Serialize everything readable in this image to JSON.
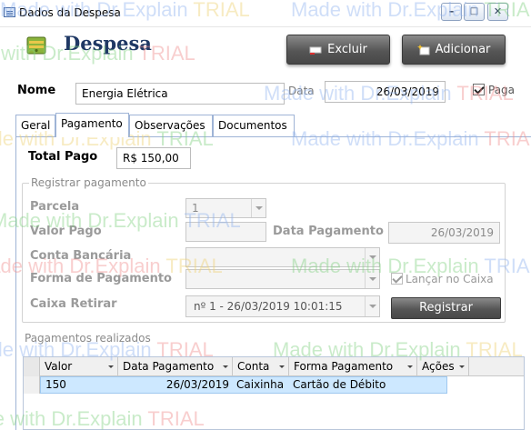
{
  "window": {
    "title": "Dados da Despesa",
    "minimize": "–",
    "maximize": "□",
    "close": "✕"
  },
  "header": {
    "title": "Despesa",
    "icon": "money-icon",
    "delete_label": "Excluir",
    "add_label": "Adicionar"
  },
  "form": {
    "name_label": "Nome",
    "name_value": "Energia Elétrica",
    "date_label": "Data",
    "date_value": "26/03/2019",
    "paid_label": "Paga",
    "paid_checked": true
  },
  "tabs": [
    "Geral",
    "Pagamento",
    "Observações",
    "Documentos"
  ],
  "active_tab": "Pagamento",
  "payment": {
    "total_label": "Total Pago",
    "total_value": "R$ 150,00",
    "group_title": "Registrar pagamento",
    "installment_label": "Parcela",
    "installment_value": "1",
    "amount_label": "Valor Pago",
    "amount_value": "",
    "pay_date_label": "Data Pagamento",
    "pay_date_value": "26/03/2019",
    "bank_label": "Conta Bancária",
    "bank_value": "",
    "method_label": "Forma de Pagamento",
    "method_value": "",
    "cash_post_label": "Lançar no Caixa",
    "cash_post_checked": true,
    "cash_label": "Caixa Retirar",
    "cash_value": "nº  1 - 26/03/2019 10:01:15",
    "register_label": "Registrar"
  },
  "payments_done": {
    "title": "Pagamentos realizados",
    "columns": [
      "Valor",
      "Data Pagamento",
      "Conta",
      "Forma Pagamento",
      "Ações"
    ],
    "rows": [
      {
        "valor": "150",
        "data": "26/03/2019",
        "conta": "Caixinha",
        "forma": "Cartão de Débito",
        "acoes": ""
      }
    ]
  },
  "watermark": {
    "text_a": "Made with Dr.Explain ",
    "text_b": "TRIAL"
  }
}
